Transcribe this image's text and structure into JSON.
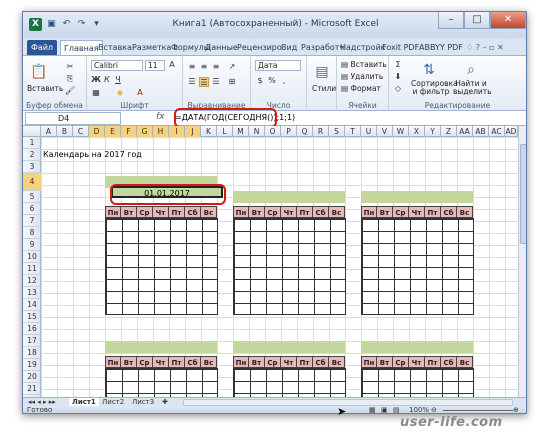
{
  "window": {
    "title": "Книга1 (Автосохраненный) - Microsoft Excel"
  },
  "tabs": [
    "Файл",
    "Главная",
    "Вставка",
    "Разметка с",
    "Формулы",
    "Данные",
    "Рецензиро",
    "Вид",
    "Разработч",
    "Надстройк",
    "Foxit PDF",
    "ABBYY PDF"
  ],
  "ribbon": {
    "clipboard": {
      "paste": "Вставить",
      "label": "Буфер обмена"
    },
    "font": {
      "name": "Calibri",
      "size": "11",
      "label": "Шрифт"
    },
    "alignment": {
      "label": "Выравнивание"
    },
    "number": {
      "format": "Дата",
      "label": "Число"
    },
    "styles": {
      "styles_btn": "Стили"
    },
    "cells": {
      "insert": "Вставить",
      "delete": "Удалить",
      "format": "Формат",
      "label": "Ячейки"
    },
    "editing": {
      "sort": "Сортировка и фильтр",
      "find": "Найти и выделить",
      "label": "Редактирование"
    }
  },
  "formula_bar": {
    "cell_ref": "D4",
    "fx": "fx",
    "formula": "=ДАТА(ГОД(СЕГОДНЯ());1;1)"
  },
  "columns": [
    "A",
    "B",
    "C",
    "D",
    "E",
    "F",
    "G",
    "H",
    "I",
    "J",
    "K",
    "L",
    "M",
    "N",
    "O",
    "P",
    "Q",
    "R",
    "S",
    "T",
    "U",
    "V",
    "W",
    "X",
    "Y",
    "Z",
    "AA",
    "AB",
    "AC",
    "AD"
  ],
  "rows": [
    "1",
    "2",
    "3",
    "4",
    "5",
    "6",
    "7",
    "8",
    "9",
    "10",
    "11",
    "12",
    "13",
    "14",
    "15",
    "16",
    "17",
    "18",
    "19",
    "20",
    "21",
    "22"
  ],
  "sheet": {
    "title": "Календарь на 2017 год",
    "date_value": "01.01.2017",
    "weekdays": [
      "Пн",
      "Вт",
      "Ср",
      "Чт",
      "Пт",
      "Сб",
      "Вс"
    ]
  },
  "sheet_tabs": [
    "Лист1",
    "Лист2",
    "Лист3"
  ],
  "status": {
    "ready": "Готово",
    "zoom": "100%"
  },
  "watermark": "user-life.com",
  "colors": {
    "header_green": "#c3d69b",
    "day_pink": "#e6b8b7",
    "highlight": "#d31a14",
    "selected": "#f9d07b"
  }
}
